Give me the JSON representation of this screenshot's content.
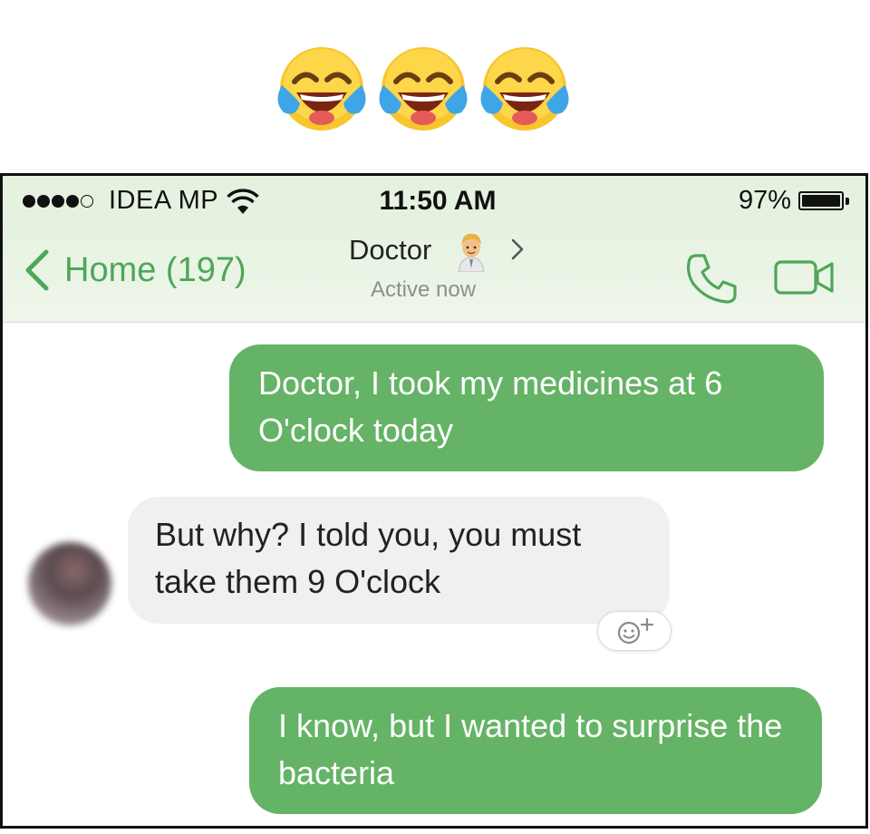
{
  "reaction_emojis": [
    {
      "icon": "face-with-tears-of-joy-icon"
    },
    {
      "icon": "face-with-tears-of-joy-icon"
    },
    {
      "icon": "face-with-tears-of-joy-icon"
    }
  ],
  "status_bar": {
    "carrier": "IDEA MP",
    "time": "11:50 AM",
    "battery": "97%",
    "signal_bars": 4,
    "signal_total": 5,
    "battery_level": 0.97
  },
  "nav": {
    "back_label": "Home (197)",
    "contact_name": "Doctor",
    "contact_status": "Active now",
    "icons": [
      "chevron-left-icon",
      "doctor-emoji-icon",
      "chevron-right-icon",
      "phone-icon",
      "video-camera-icon"
    ]
  },
  "messages": [
    {
      "direction": "outgoing",
      "text": "Doctor, I took my medicines at 6 O'clock today"
    },
    {
      "direction": "incoming",
      "text": "But why? I told you, you must take them 9 O'clock"
    },
    {
      "direction": "outgoing",
      "text": "I know, but I wanted to surprise the bacteria"
    }
  ],
  "colors": {
    "accent": "#4fa65a",
    "outgoing_bubble": "#65b366",
    "incoming_bubble": "#f0f0f0",
    "header_bg": "#e3f1de"
  }
}
